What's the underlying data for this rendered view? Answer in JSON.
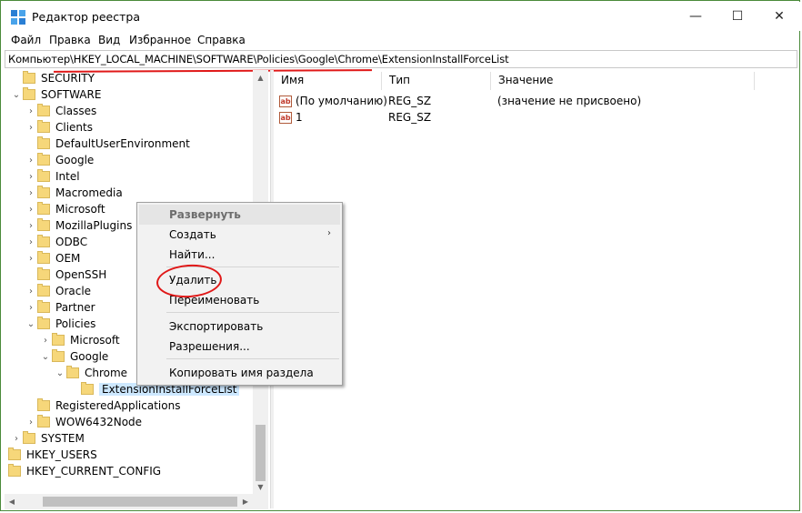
{
  "window": {
    "title": "Редактор реестра",
    "controls": {
      "minimize": "—",
      "maximize": "☐",
      "close": "✕"
    }
  },
  "menu": [
    "Файл",
    "Правка",
    "Вид",
    "Избранное",
    "Справка"
  ],
  "address": "Компьютер\\HKEY_LOCAL_MACHINE\\SOFTWARE\\Policies\\Google\\Chrome\\ExtensionInstallForceList",
  "tree": [
    {
      "label": "SECURITY",
      "expander": ""
    },
    {
      "label": "SOFTWARE",
      "expander": "⌄"
    },
    {
      "label": "Classes",
      "expander": "›"
    },
    {
      "label": "Clients",
      "expander": "›"
    },
    {
      "label": "DefaultUserEnvironment",
      "expander": ""
    },
    {
      "label": "Google",
      "expander": "›"
    },
    {
      "label": "Intel",
      "expander": "›"
    },
    {
      "label": "Macromedia",
      "expander": "›"
    },
    {
      "label": "Microsoft",
      "expander": "›"
    },
    {
      "label": "MozillaPlugins",
      "expander": "›"
    },
    {
      "label": "ODBC",
      "expander": "›"
    },
    {
      "label": "OEM",
      "expander": "›"
    },
    {
      "label": "OpenSSH",
      "expander": ""
    },
    {
      "label": "Oracle",
      "expander": "›"
    },
    {
      "label": "Partner",
      "expander": "›"
    },
    {
      "label": "Policies",
      "expander": "⌄"
    },
    {
      "label": "Microsoft",
      "expander": "›"
    },
    {
      "label": "Google",
      "expander": "⌄"
    },
    {
      "label": "Chrome",
      "expander": "⌄"
    },
    {
      "label": "ExtensionInstallForceList",
      "expander": ""
    },
    {
      "label": "RegisteredApplications",
      "expander": ""
    },
    {
      "label": "WOW6432Node",
      "expander": "›"
    },
    {
      "label": "SYSTEM",
      "expander": "›"
    },
    {
      "label": "HKEY_USERS",
      "expander": "›"
    },
    {
      "label": "HKEY_CURRENT_CONFIG",
      "expander": "›"
    }
  ],
  "list": {
    "columns": [
      "Имя",
      "Тип",
      "Значение"
    ],
    "rows": [
      {
        "icon": "ab",
        "name": "(По умолчанию)",
        "type": "REG_SZ",
        "value": "(значение не присвоено)"
      },
      {
        "icon": "ab",
        "name": "1",
        "type": "REG_SZ",
        "value": ""
      }
    ]
  },
  "context_menu": {
    "items": [
      {
        "label": "Развернуть"
      },
      {
        "label": "Создать",
        "submenu_arrow": "›"
      },
      {
        "label": "Найти..."
      },
      {
        "label": "Удалить"
      },
      {
        "label": "Переименовать"
      },
      {
        "label": "Экспортировать"
      },
      {
        "label": "Разрешения..."
      },
      {
        "label": "Копировать имя раздела"
      }
    ]
  },
  "annotations": {
    "highlight_color": "#e01818"
  }
}
